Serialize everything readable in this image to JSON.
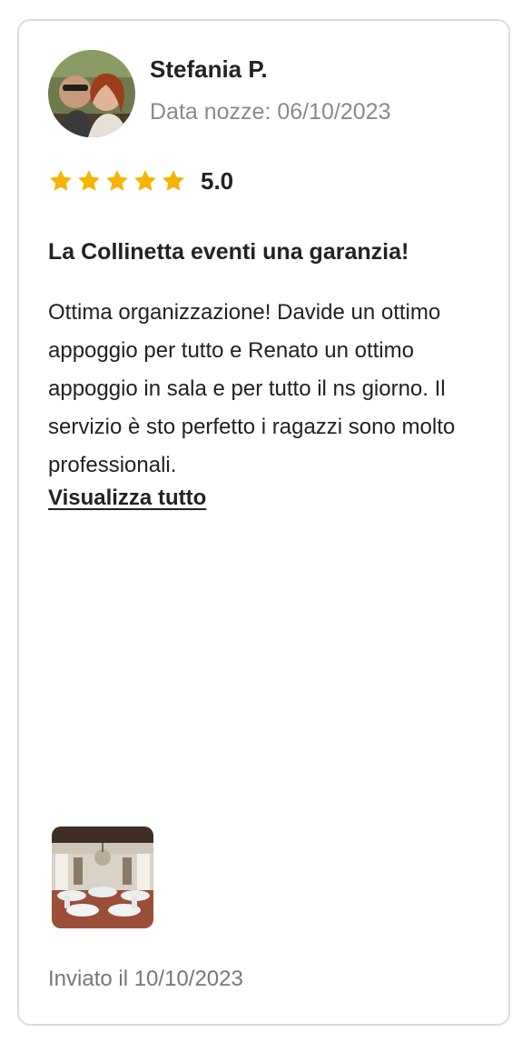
{
  "review": {
    "author_name": "Stefania P.",
    "wedding_date": "Data nozze: 06/10/2023",
    "rating": {
      "stars": 5,
      "value": "5.0",
      "star_color": "#f5b400"
    },
    "title": "La Collinetta eventi una garanzia!",
    "body": "Ottima organizzazione! Davide un ottimo appoggio per tutto e Renato un ottimo appoggio in sala e per tutto il ns giorno. Il servizio è sto perfetto i ragazzi sono molto professionali.",
    "read_more_label": "Visualizza tutto",
    "sent_date": "Inviato il 10/10/2023"
  },
  "icons": {
    "avatar": "avatar-photo",
    "star": "star-icon",
    "photo": "venue-hall-photo-thumbnail"
  }
}
